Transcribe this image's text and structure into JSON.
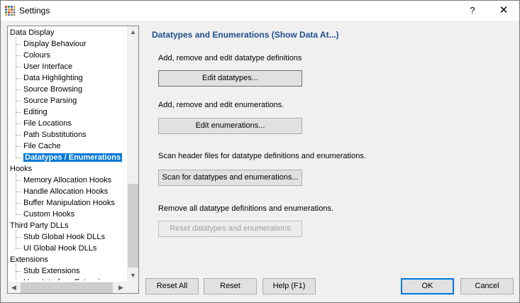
{
  "window": {
    "title": "Settings",
    "help": "?",
    "close": "✕"
  },
  "tree": {
    "nodes": [
      {
        "label": "Data Display",
        "level": 0
      },
      {
        "label": "Display Behaviour",
        "level": 1
      },
      {
        "label": "Colours",
        "level": 1
      },
      {
        "label": "User Interface",
        "level": 1
      },
      {
        "label": "Data Highlighting",
        "level": 1
      },
      {
        "label": "Source Browsing",
        "level": 1
      },
      {
        "label": "Source Parsing",
        "level": 1
      },
      {
        "label": "Editing",
        "level": 1
      },
      {
        "label": "File Locations",
        "level": 1
      },
      {
        "label": "Path Substitutions",
        "level": 1
      },
      {
        "label": "File Cache",
        "level": 1
      },
      {
        "label": "Datatypes / Enumerations",
        "level": 1,
        "selected": true
      },
      {
        "label": "Hooks",
        "level": 0
      },
      {
        "label": "Memory Allocation Hooks",
        "level": 1
      },
      {
        "label": "Handle Allocation Hooks",
        "level": 1
      },
      {
        "label": "Buffer Manipulation Hooks",
        "level": 1
      },
      {
        "label": "Custom Hooks",
        "level": 1
      },
      {
        "label": "Third Party DLLs",
        "level": 0
      },
      {
        "label": "Stub Global Hook DLLs",
        "level": 1
      },
      {
        "label": "UI Global Hook DLLs",
        "level": 1
      },
      {
        "label": "Extensions",
        "level": 0
      },
      {
        "label": "Stub Extensions",
        "level": 1
      },
      {
        "label": "User Interface Extensions",
        "level": 1
      }
    ]
  },
  "panel": {
    "heading": "Datatypes and Enumerations (Show Data At...)",
    "sections": [
      {
        "desc": "Add, remove and edit datatype definitions",
        "button": "Edit datatypes...",
        "enabled": true
      },
      {
        "desc": "Add, remove and edit enumerations.",
        "button": "Edit enumerations...",
        "enabled": true
      },
      {
        "desc": "Scan header files for datatype definitions and enumerations.",
        "button": "Scan for datatypes and enumerations...",
        "enabled": true
      },
      {
        "desc": "Remove all datatype definitions and enumerations.",
        "button": "Reset datatypes and enumerations",
        "enabled": false
      }
    ]
  },
  "footer": {
    "reset_all": "Reset All",
    "reset": "Reset",
    "help": "Help (F1)",
    "ok": "OK",
    "cancel": "Cancel"
  }
}
